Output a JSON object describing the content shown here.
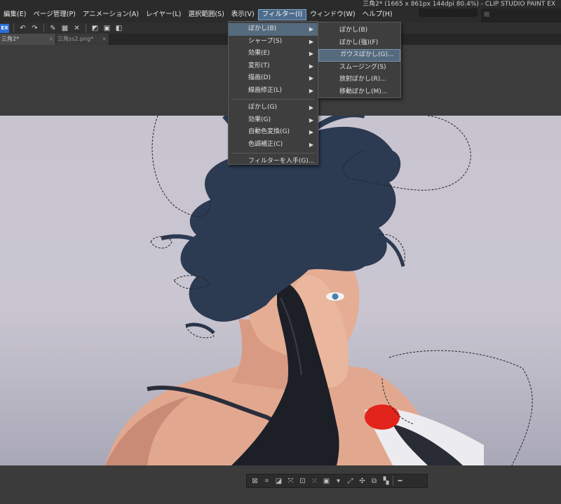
{
  "window": {
    "title": "三角2* (1665 x 861px 144dpi 80.4%)  - CLIP STUDIO PAINT EX",
    "right_panel_label": "縮"
  },
  "menubar": {
    "items": [
      {
        "label": "編集(E)"
      },
      {
        "label": "ページ管理(P)"
      },
      {
        "label": "アニメーション(A)"
      },
      {
        "label": "レイヤー(L)"
      },
      {
        "label": "選択範囲(S)"
      },
      {
        "label": "表示(V)"
      },
      {
        "label": "フィルター(I)",
        "active": true
      },
      {
        "label": "ウィンドウ(W)"
      },
      {
        "label": "ヘルプ(H)"
      }
    ]
  },
  "toolbar": {
    "icons": [
      "app-logo-icon",
      "undo-icon",
      "redo-icon",
      "pen-icon",
      "grid-icon",
      "clear-icon",
      "transform-icon",
      "layer-icon",
      "panel-icon"
    ],
    "app_logo_label": "EX"
  },
  "tabs": [
    {
      "label": "三角2*"
    },
    {
      "label": "三角ss2.png*"
    }
  ],
  "filter_menu": {
    "items": [
      {
        "label": "ぼかし(B)",
        "submenu": true,
        "highlight": true
      },
      {
        "label": "シャープ(S)",
        "submenu": true
      },
      {
        "label": "効果(E)",
        "submenu": true
      },
      {
        "label": "変形(T)",
        "submenu": true
      },
      {
        "label": "描画(D)",
        "submenu": true
      },
      {
        "label": "線画修正(L)",
        "submenu": true
      },
      {
        "label": "ぼかし(G)",
        "submenu": true
      },
      {
        "label": "効果(G)",
        "submenu": true
      },
      {
        "label": "自動色変換(G)",
        "submenu": true
      },
      {
        "label": "色調補正(C)",
        "submenu": true
      },
      {
        "label": "フィルターを入手(G)..."
      }
    ]
  },
  "blur_submenu": {
    "items": [
      {
        "label": "ぼかし(B)"
      },
      {
        "label": "ぼかし(強)(F)"
      },
      {
        "label": "ガウスぼかし(G)...",
        "highlight": true
      },
      {
        "label": "スムージング(S)"
      },
      {
        "label": "放射ぼかし(R)..."
      },
      {
        "label": "移動ぼかし(M)..."
      }
    ]
  },
  "colors": {
    "menu_highlight": "#566a7e",
    "active_menu": "#4e6d8c",
    "hair": "#2c3a52",
    "skin": "#e2a88f",
    "glove": "#1d1f27",
    "canvas_bg": "#c7c4d0",
    "accent_red": "#e3241c"
  },
  "bottom_toolbar": {
    "icons": [
      "deselect-icon",
      "crop-icon",
      "invert-selection-icon",
      "expand-selection-icon",
      "shrink-selection-icon",
      "clear-outside-icon",
      "fill-selection-icon",
      "transform-icon",
      "dropdown-arrow-icon",
      "scale-icon",
      "move-icon",
      "copy-paste-icon",
      "convert-icon",
      "settings-icon",
      "menu-dash-icon"
    ]
  }
}
